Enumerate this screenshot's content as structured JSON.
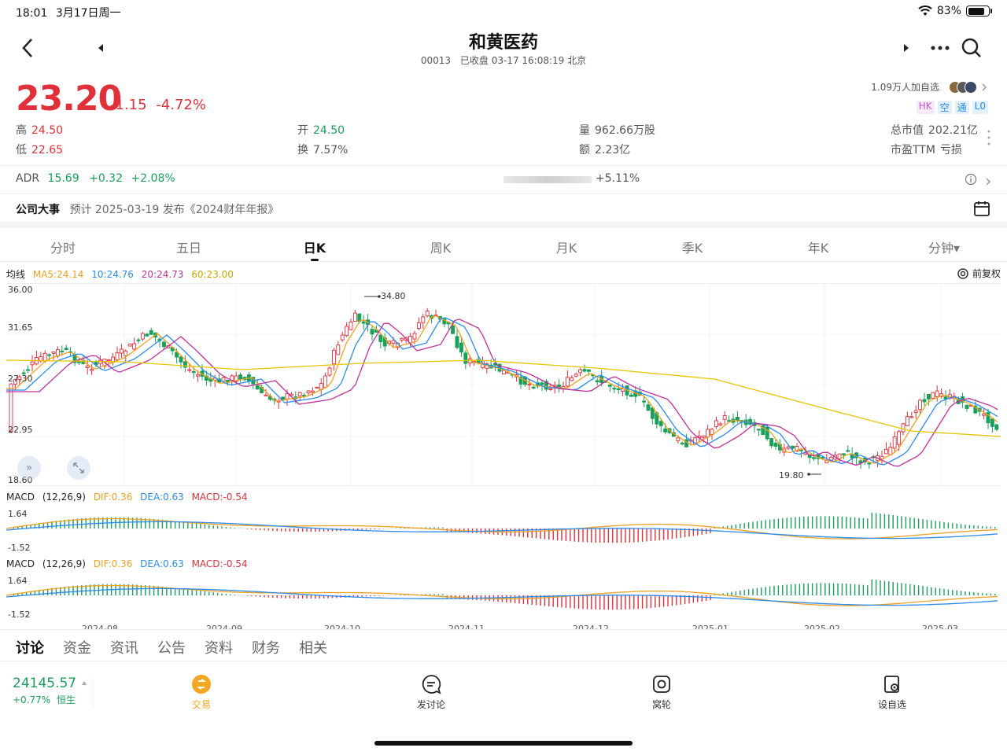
{
  "status": {
    "time": "18:01",
    "date": "3月17日周一",
    "battery": "83%",
    "battery_level": 0.83
  },
  "header": {
    "title": "和黄医药",
    "code": "00013",
    "market_status": "已收盘 03-17 16:08:19 北京"
  },
  "quote": {
    "price": "23.20",
    "change": "-1.15",
    "change_pct": "-4.72%",
    "high_label": "高",
    "high": "24.50",
    "low_label": "低",
    "low": "22.65",
    "open_label": "开",
    "open": "24.50",
    "turnover_label": "换",
    "turnover": "7.57%",
    "volume_label": "量",
    "volume": "962.66万股",
    "amount_label": "额",
    "amount": "2.23亿",
    "mktcap_label": "总市值",
    "mktcap": "202.21亿",
    "pe_label": "市盈TTM",
    "pe": "亏损",
    "watchers": "1.09万人加自选",
    "badges": [
      {
        "text": "HK",
        "color": "#c05ad8"
      },
      {
        "text": "空",
        "color": "#2a8cf0"
      },
      {
        "text": "通",
        "color": "#2a8cf0"
      },
      {
        "text": "L0",
        "color": "#2a8cf0"
      }
    ]
  },
  "adr": {
    "label": "ADR",
    "price": "15.69",
    "change": "+0.32",
    "pct": "+2.08%",
    "premium": "+5.11%"
  },
  "event": {
    "label": "公司大事",
    "text": "预计 2025-03-19 发布《2024财年年报》"
  },
  "period_tabs": [
    "分时",
    "五日",
    "日K",
    "周K",
    "月K",
    "季K",
    "年K",
    "分钟▾"
  ],
  "active_tab": 2,
  "ma_legend": {
    "title": "均线",
    "ma5": "MA5:24.14",
    "ma10": "10:24.76",
    "ma20": "20:24.73",
    "ma60": "60:23.00",
    "adjust": "前复权"
  },
  "price_axis": [
    "36.00",
    "31.65",
    "27.30",
    "22.95",
    "18.60"
  ],
  "annotations": {
    "high": "34.80",
    "low": "19.80"
  },
  "macd": {
    "label": "MACD",
    "params": "(12,26,9)",
    "dif": "DIF:0.36",
    "dea": "DEA:0.63",
    "macd": "MACD:-0.54",
    "axis": [
      "1.64",
      "-1.52"
    ]
  },
  "date_axis": [
    "2024-08",
    "2024-09",
    "2024-10",
    "2024-11",
    "2024-12",
    "2025-01",
    "2025-02",
    "2025-03"
  ],
  "news_tabs": [
    "讨论",
    "资金",
    "资讯",
    "公告",
    "资料",
    "财务",
    "相关"
  ],
  "index": {
    "value": "24145.57",
    "change": "+0.77%",
    "name": "恒生"
  },
  "bottom_nav": [
    "交易",
    "发讨论",
    "窝轮",
    "设自选"
  ],
  "colors": {
    "up": "#e0303a",
    "down": "#19a05a",
    "ma5": "#f0a020",
    "ma10": "#2a8cf0",
    "ma20": "#c0309a",
    "ma60": "#e8c400",
    "brand": "#f5a623"
  }
}
